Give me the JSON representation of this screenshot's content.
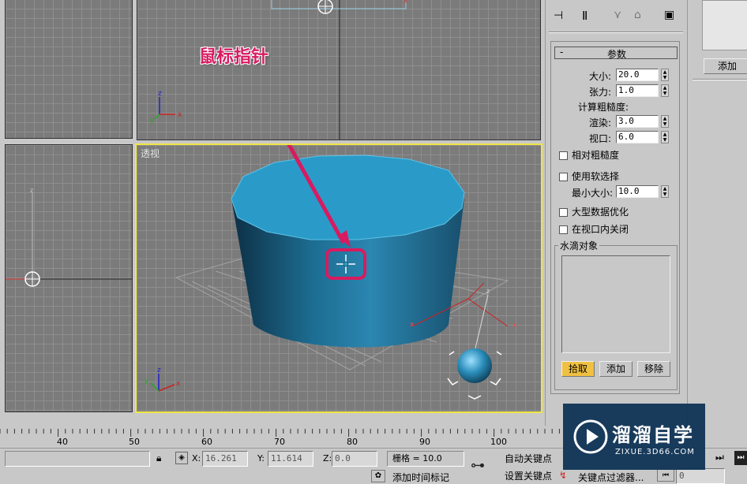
{
  "viewports": {
    "perspective_label": "透视"
  },
  "annotation": {
    "label": "鼠标指针"
  },
  "toolbar": {
    "pin_icon": "pin-icon",
    "separator_icon": "pipe-icon",
    "fork_icon": "fork-icon",
    "trash_icon": "trash-icon",
    "config_icon": "config-icon"
  },
  "params": {
    "rollout_title": "参数",
    "collapse_symbol": "-",
    "size_label": "大小:",
    "size_value": "20.0",
    "tension_label": "张力:",
    "tension_value": "1.0",
    "roughness_heading": "计算粗糙度:",
    "render_label": "渲染:",
    "render_value": "3.0",
    "viewport_label": "视口:",
    "viewport_value": "6.0",
    "relative_roughness": "相对粗糙度",
    "use_soft_selection": "使用软选择",
    "min_size_label": "最小大小:",
    "min_size_value": "10.0",
    "large_data_opt": "大型数据优化",
    "off_in_viewport": "在视口内关闭",
    "drop_objects_title": "水滴对象",
    "pick_button": "拾取",
    "add_button": "添加",
    "remove_button": "移除"
  },
  "right_panel": {
    "add_button": "添加"
  },
  "timeline": {
    "ticks": [
      "40",
      "50",
      "60",
      "70",
      "80",
      "90",
      "100"
    ]
  },
  "status": {
    "x_label": "X:",
    "x_value": "16.261",
    "y_label": "Y:",
    "y_value": "11.614",
    "z_label": "Z:",
    "z_value": "0.0",
    "grid_text": "栅格 = 10.0",
    "auto_key": "自动关键点",
    "set_key": "设置关键点",
    "add_time_tag": "添加时间标记",
    "key_filters": "关键点过滤器...",
    "frame_value": "0"
  },
  "watermark": {
    "brand": "溜溜自学",
    "url": "ZIXUE.3D66.COM"
  },
  "colors": {
    "accent_yellow": "#f0e640",
    "annotation_magenta": "#d81b60",
    "cylinder_top": "#2a9bc8",
    "cylinder_side": "#1c6a8e"
  }
}
